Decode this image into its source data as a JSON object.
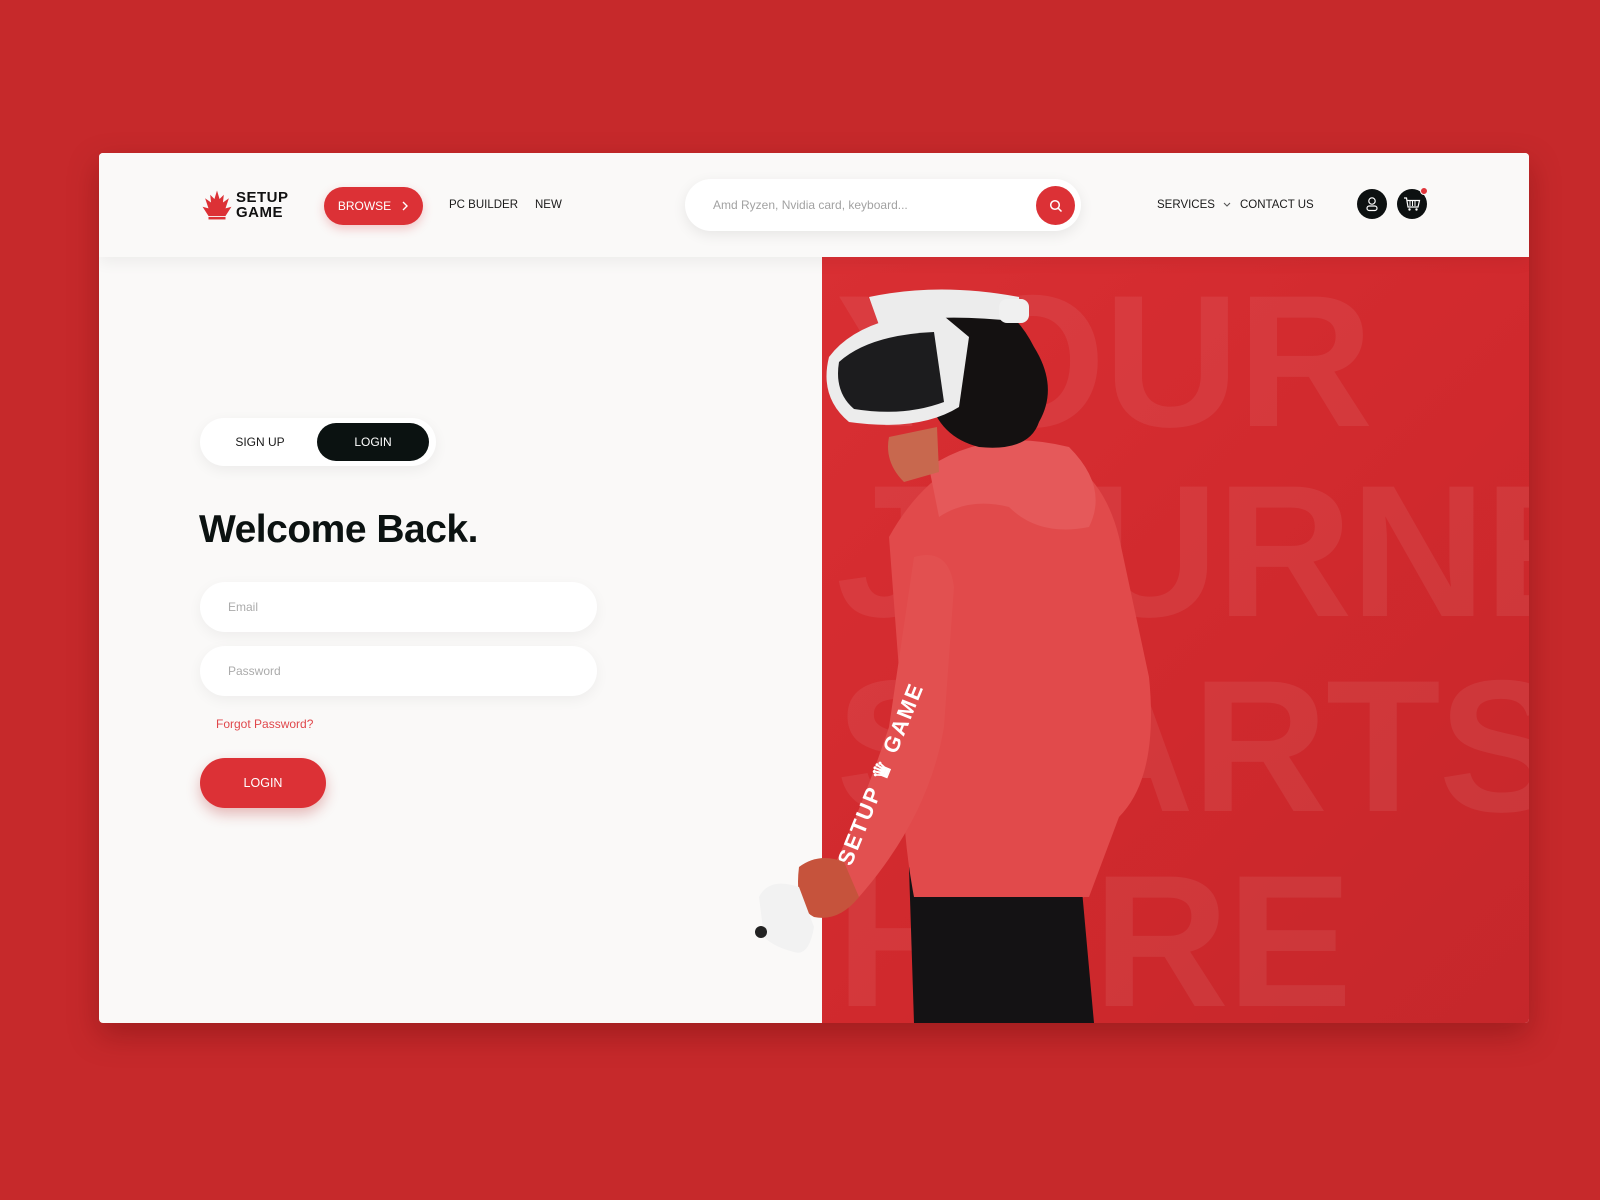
{
  "brand": {
    "name_top": "SETUP",
    "name_bottom": "GAME",
    "accent_color": "#dc3136",
    "dark_color": "#0b1211",
    "page_bg": "#c6292b"
  },
  "header": {
    "browse_label": "BROWSE",
    "browse_icon": "chevron-right-icon",
    "nav": [
      "PC BUILDER",
      "NEW"
    ],
    "search": {
      "placeholder": "Amd Ryzen, Nvidia card, keyboard...",
      "value": "",
      "icon": "search-icon"
    },
    "services_label": "SERVICES",
    "services_icon": "chevron-down-icon",
    "contact_label": "CONTACT US",
    "account_icon": "user-icon",
    "cart_icon": "cart-icon",
    "cart_badge": true
  },
  "auth": {
    "tabs": [
      {
        "label": "SIGN UP",
        "active": false
      },
      {
        "label": "LOGIN",
        "active": true
      }
    ],
    "title": "Welcome Back.",
    "email": {
      "placeholder": "Email",
      "value": ""
    },
    "password": {
      "placeholder": "Password",
      "value": ""
    },
    "forgot_label": "Forgot Password?",
    "submit_label": "LOGIN"
  },
  "hero": {
    "bg_words": [
      "YOUR",
      "JOURNEY",
      "STARTS",
      "HERE"
    ],
    "image_alt": "Person wearing VR headset and SETUP GAME hoodie holding a controller",
    "sleeve_print": "SETUP GAME"
  }
}
